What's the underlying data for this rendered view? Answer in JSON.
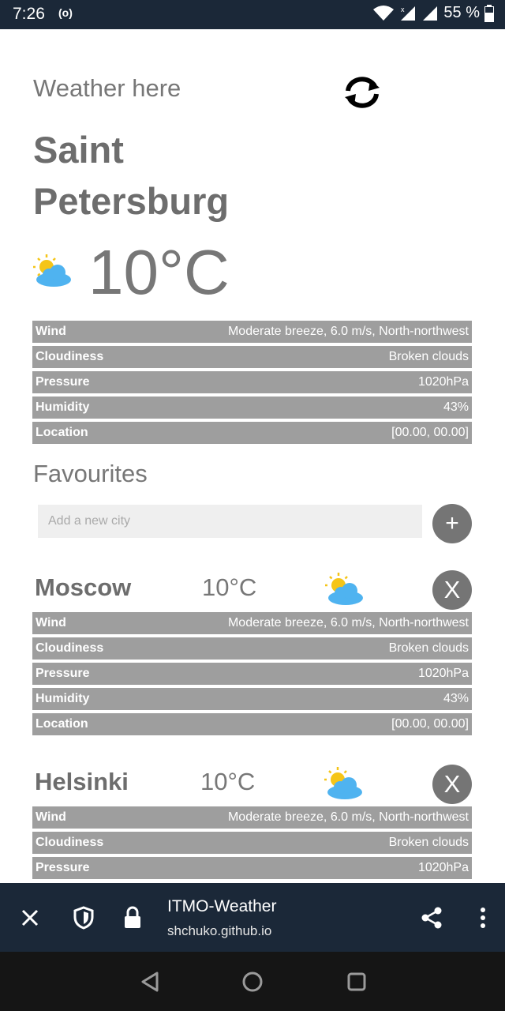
{
  "status_bar": {
    "time": "7:26",
    "radio": "(o)",
    "battery": "55 %"
  },
  "app": {
    "heading": "Weather here",
    "current": {
      "city": "Saint Petersburg",
      "temperature": "10°C",
      "details": [
        {
          "key": "Wind",
          "value": "Moderate breeze, 6.0 m/s, North-northwest"
        },
        {
          "key": "Cloudiness",
          "value": "Broken clouds"
        },
        {
          "key": "Pressure",
          "value": "1020hPa"
        },
        {
          "key": "Humidity",
          "value": "43%"
        },
        {
          "key": "Location",
          "value": "[00.00, 00.00]"
        }
      ]
    },
    "favourites": {
      "title": "Favourites",
      "placeholder": "Add a new city",
      "add_label": "+",
      "items": [
        {
          "city": "Moscow",
          "temperature": "10°C",
          "remove_label": "X",
          "details": [
            {
              "key": "Wind",
              "value": "Moderate breeze, 6.0 m/s, North-northwest"
            },
            {
              "key": "Cloudiness",
              "value": "Broken clouds"
            },
            {
              "key": "Pressure",
              "value": "1020hPa"
            },
            {
              "key": "Humidity",
              "value": "43%"
            },
            {
              "key": "Location",
              "value": "[00.00, 00.00]"
            }
          ]
        },
        {
          "city": "Helsinki",
          "temperature": "10°C",
          "remove_label": "X",
          "details": [
            {
              "key": "Wind",
              "value": "Moderate breeze, 6.0 m/s, North-northwest"
            },
            {
              "key": "Cloudiness",
              "value": "Broken clouds"
            },
            {
              "key": "Pressure",
              "value": "1020hPa"
            }
          ]
        }
      ]
    }
  },
  "browser": {
    "title": "ITMO-Weather",
    "url": "shchuko.github.io"
  },
  "icons": {
    "weather": "partly-cloudy-icon",
    "refresh": "refresh-icon",
    "colors": {
      "sun": "#f5c518",
      "cloud": "#4fb3f0",
      "row_bg": "#9e9e9e",
      "bar_bg": "#1b2838"
    }
  }
}
